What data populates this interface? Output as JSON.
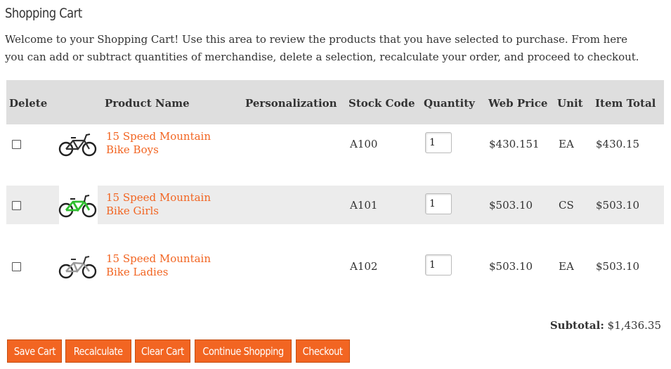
{
  "page": {
    "title": "Shopping Cart",
    "intro_line1": "Welcome to your Shopping Cart! Use this area to review the products that you have selected to purchase. From here",
    "intro_line2": "you can add or subtract quantities of merchandise, delete a selection, recalculate your order, and proceed to checkout."
  },
  "table": {
    "headers": {
      "delete": "Delete",
      "product_name": "Product Name",
      "personalization": "Personalization",
      "stock_code": "Stock Code",
      "quantity": "Quantity",
      "web_price": "Web Price",
      "unit": "Unit",
      "item_total": "Item Total"
    },
    "rows": [
      {
        "checked": false,
        "image_icon": "black-bmx-bike-icon",
        "name_line1": "15 Speed Mountain",
        "name_line2": "Bike Boys",
        "personalization": "",
        "stock_code": "A100",
        "quantity": "1",
        "web_price": "$430.151",
        "unit": "EA",
        "item_total": "$430.15"
      },
      {
        "checked": false,
        "image_icon": "green-bmx-bike-icon",
        "name_line1": "15 Speed Mountain",
        "name_line2": "Bike Girls",
        "personalization": "",
        "stock_code": "A101",
        "quantity": "1",
        "web_price": "$503.10",
        "unit": "CS",
        "item_total": "$503.10"
      },
      {
        "checked": false,
        "image_icon": "silver-mountain-bike-icon",
        "name_line1": "15 Speed Mountain",
        "name_line2": "Bike Ladies",
        "personalization": "",
        "stock_code": "A102",
        "quantity": "1",
        "web_price": "$503.10",
        "unit": "EA",
        "item_total": "$503.10"
      }
    ]
  },
  "summary": {
    "subtotal_label": "Subtotal:",
    "subtotal_value": "$1,436.35"
  },
  "actions": {
    "save_cart": "Save Cart",
    "recalculate": "Recalculate",
    "clear_cart": "Clear Cart",
    "continue_shopping": "Continue Shopping",
    "checkout": "Checkout"
  },
  "colors": {
    "accent": "#f26522",
    "header_bg": "#dedede",
    "alt_row_bg": "#ececec",
    "text": "#333333"
  }
}
